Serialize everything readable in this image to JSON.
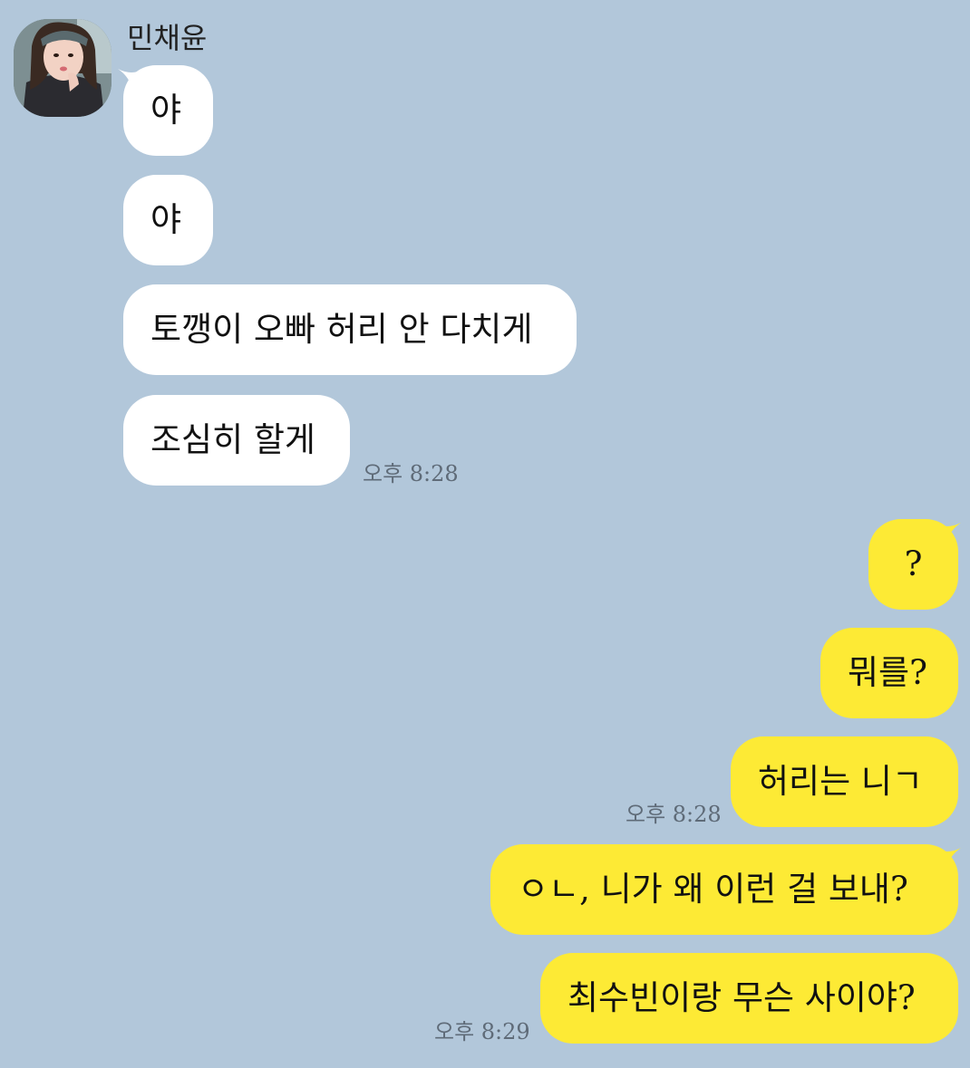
{
  "contact": {
    "name": "민채윤"
  },
  "messages": [
    {
      "side": "in",
      "text": "야"
    },
    {
      "side": "in",
      "text": "야"
    },
    {
      "side": "in",
      "text": "토깽이 오빠 허리 안 다치게"
    },
    {
      "side": "in",
      "text": "조심히 할게",
      "time": "오후 8:28"
    },
    {
      "side": "out",
      "text": "?"
    },
    {
      "side": "out",
      "text": "뭐를?"
    },
    {
      "side": "out",
      "text": "허리는 니ㄱ",
      "time": "오후 8:28"
    },
    {
      "side": "out",
      "text": "ㅇㄴ, 니가 왜 이런 걸 보내?"
    },
    {
      "side": "out",
      "text": "최수빈이랑 무슨 사이야?",
      "time": "오후 8:29"
    }
  ],
  "colors": {
    "background": "#b2c7da",
    "incoming_bubble": "#ffffff",
    "outgoing_bubble": "#fdea35"
  }
}
